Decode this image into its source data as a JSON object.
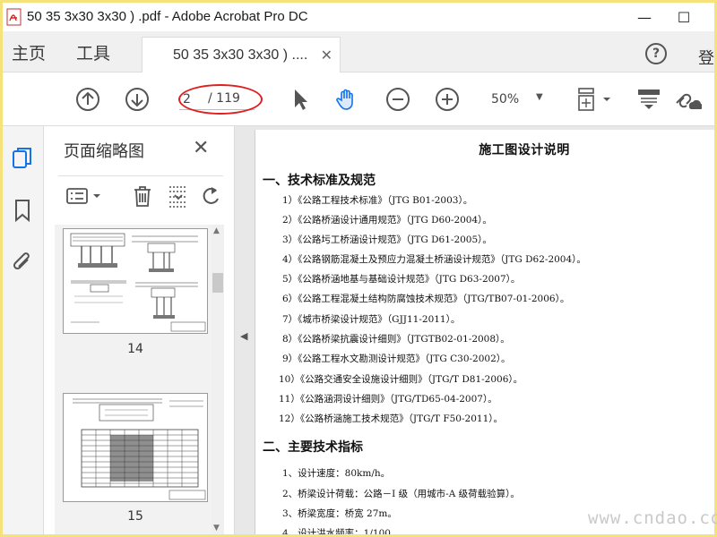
{
  "window": {
    "title": "50 35 3x30 3x30 ) .pdf - Adobe Acrobat Pro DC",
    "icon": "acrobat-icon",
    "minimize": "—",
    "maximize": "☐"
  },
  "tabs": {
    "home": "主页",
    "tools": "工具",
    "document": "50 35 3x30 3x30 ) ....",
    "close": "✕",
    "login": "登"
  },
  "toolbar": {
    "current_page": "2",
    "total_pages": "/ 119",
    "zoom": "50%"
  },
  "panel": {
    "title": "页面缩略图",
    "close": "✕",
    "thumbnails": [
      {
        "page": "14"
      },
      {
        "page": "15"
      }
    ]
  },
  "document": {
    "title": "施工图设计说明",
    "sections": [
      {
        "heading": "一、技术标准及规范",
        "items": [
          "1）《公路工程技术标准》（JTG B01-2003）。",
          "2）《公路桥涵设计通用规范》（JTG D60-2004）。",
          "3）《公路圬工桥涵设计规范》（JTG D61-2005）。",
          "4）《公路钢筋混凝土及预应力混凝土桥涵设计规范》（JTG D62-2004）。",
          "5）《公路桥涵地基与基础设计规范》（JTG D63-2007）。",
          "6）《公路工程混凝土结构防腐蚀技术规范》（JTG/TB07-01-2006）。",
          "7）《城市桥梁设计规范》（GJJ11-2011）。",
          "8）《公路桥梁抗震设计细则》（JTGTB02-01-2008）。",
          "9）《公路工程水文勘测设计规范》（JTG C30-2002）。",
          "10）《公路交通安全设施设计细则》（JTG/T D81-2006）。",
          "11）《公路涵洞设计细则》（JTG/TD65-04-2007）。",
          "12）《公路桥涵施工技术规范》（JTG/T F50-2011）。"
        ]
      },
      {
        "heading": "二、主要技术指标",
        "items": [
          "1、设计速度：80km/h。",
          "2、桥梁设计荷载：公路－I 级（用城市-A 级荷载验算）。",
          "3、桥梁宽度：桥宽 27m。",
          "4、设计洪水频率：1/100。"
        ]
      }
    ]
  },
  "watermark": "www.cndao.com",
  "colors": {
    "frame": "#f6e27a",
    "annotation": "#e02020",
    "accent": "#1473e6"
  }
}
